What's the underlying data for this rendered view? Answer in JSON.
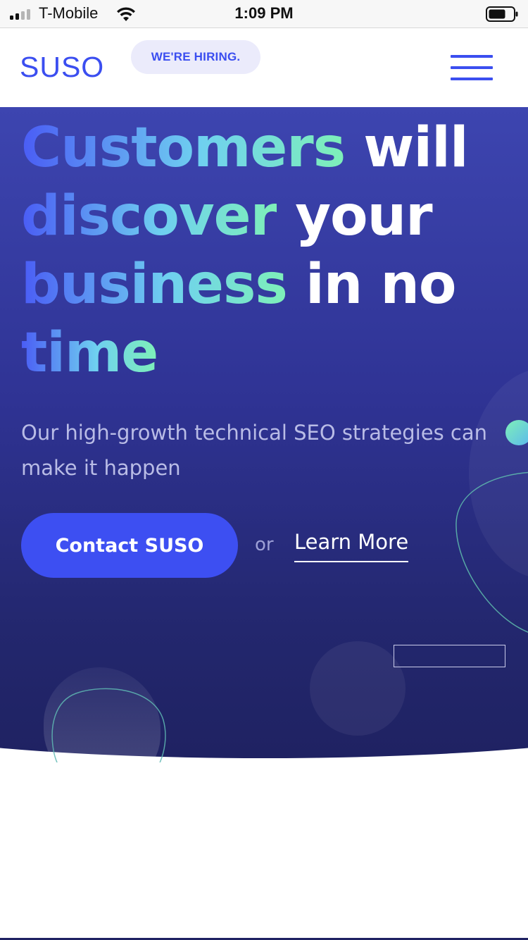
{
  "status_bar": {
    "carrier": "T-Mobile",
    "time": "1:09 PM",
    "icons": [
      "signal-icon",
      "wifi-icon",
      "battery-icon"
    ]
  },
  "header": {
    "logo": "SUSO",
    "hiring_badge": "WE'RE HIRING.",
    "menu_icon": "hamburger-menu-icon"
  },
  "hero": {
    "headline": {
      "line1_a": "Customers",
      "line1_b": " will",
      "line2_a": "discover",
      "line2_b": " your",
      "line3_a": "business",
      "line3_b": " in no",
      "line4_a": "time"
    },
    "subtitle": "Our high-growth technical SEO strategies can make it happen",
    "cta_label": "Contact SUSO",
    "or_label": "or",
    "learn_more_label": "Learn More"
  },
  "colors": {
    "brand_blue": "#3b4ef0",
    "hero_top": "#3d45b0",
    "hero_bottom": "#1f2262",
    "accent_green": "#7ef0b8",
    "accent_cyan": "#6fd0f0"
  }
}
